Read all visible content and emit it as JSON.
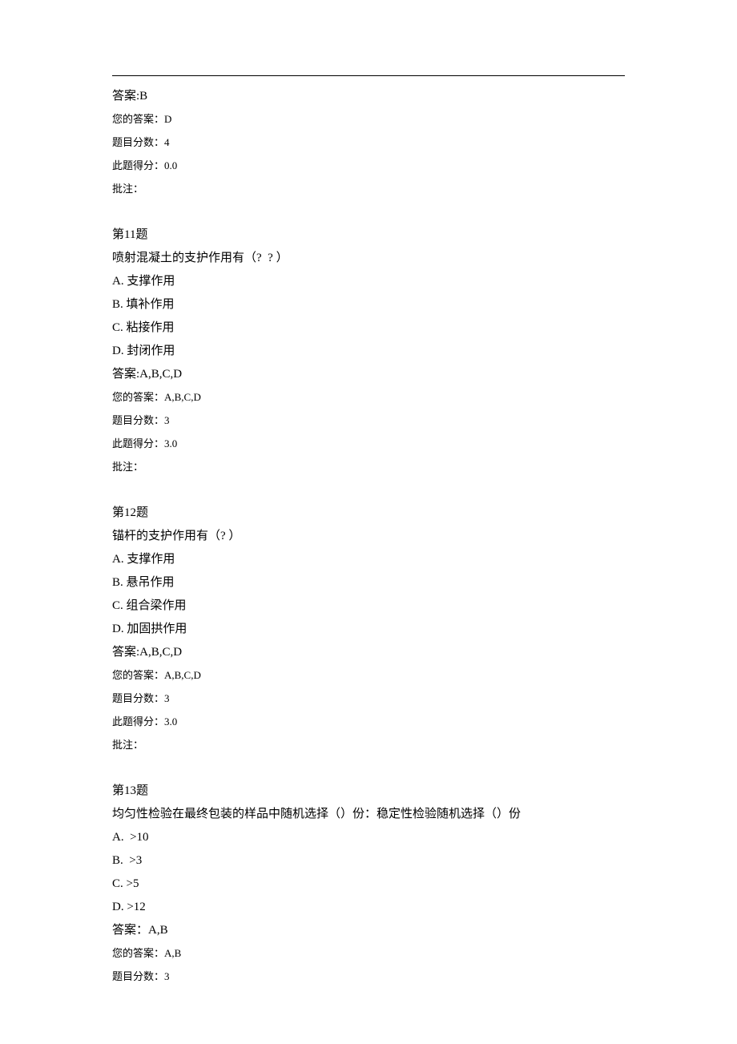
{
  "q10_tail": {
    "answer_label": "答案:B",
    "your_answer_label": "您的答案：D",
    "score_label": "题目分数：4",
    "got_label": "此题得分：0.0",
    "note_label": "批注："
  },
  "q11": {
    "header": "第11题",
    "stem": "喷射混凝土的支护作用有（?  ? ）",
    "optA": "A. 支撑作用",
    "optB": "B. 填补作用",
    "optC": "C. 粘接作用",
    "optD": "D. 封闭作用",
    "answer_label": "答案:A,B,C,D",
    "your_answer_label": "您的答案：A,B,C,D",
    "score_label": "题目分数：3",
    "got_label": "此题得分：3.0",
    "note_label": "批注："
  },
  "q12": {
    "header": "第12题",
    "stem": "锚杆的支护作用有（? ）",
    "optA": "A. 支撑作用",
    "optB": "B. 悬吊作用",
    "optC": "C. 组合梁作用",
    "optD": "D. 加固拱作用",
    "answer_label": "答案:A,B,C,D",
    "your_answer_label": "您的答案：A,B,C,D",
    "score_label": "题目分数：3",
    "got_label": "此题得分：3.0",
    "note_label": "批注："
  },
  "q13": {
    "header": "第13题",
    "stem": "均匀性检验在最终包装的样品中随机选择（）份：稳定性检验随机选择（）份",
    "optA": "A.  >10",
    "optB": "B.  >3",
    "optC": "C. >5",
    "optD": "D. >12",
    "answer_label": "答案：A,B",
    "your_answer_label": "您的答案：A,B",
    "score_label": "题目分数：3"
  }
}
